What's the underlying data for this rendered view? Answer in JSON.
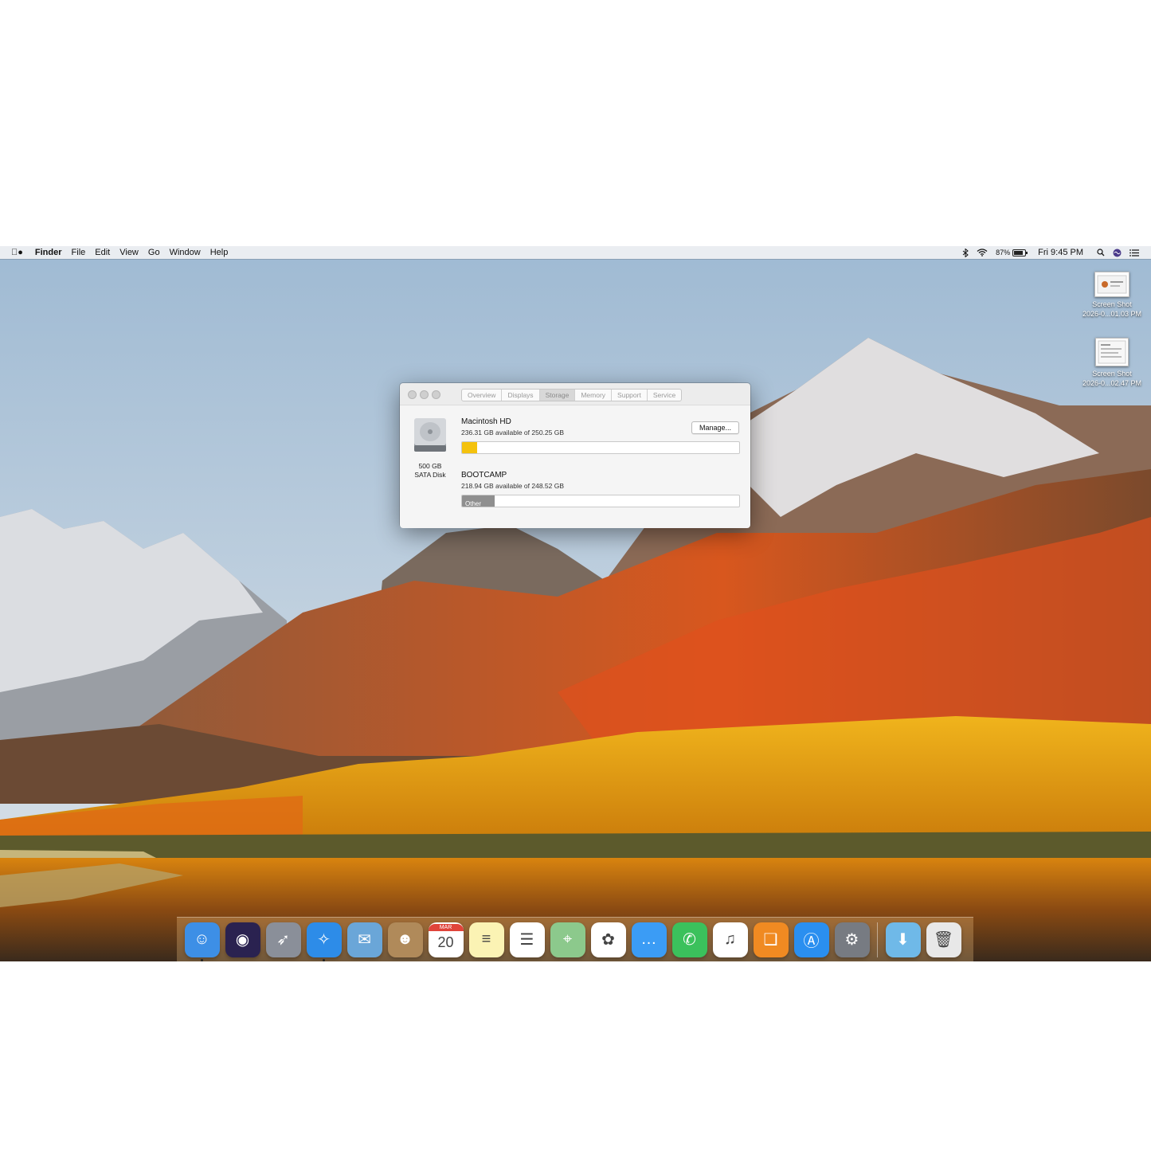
{
  "menubar": {
    "app_name": "Finder",
    "menus": [
      "File",
      "Edit",
      "View",
      "Go",
      "Window",
      "Help"
    ],
    "battery_percent": "87%",
    "battery_level": 0.87,
    "clock": "Fri 9:45 PM"
  },
  "desktop": {
    "icons": [
      {
        "line1": "Screen Shot",
        "line2": "2026-0...01.03 PM"
      },
      {
        "line1": "Screen Shot",
        "line2": "2026-0...02.47 PM"
      }
    ]
  },
  "about_window": {
    "tabs": [
      "Overview",
      "Displays",
      "Storage",
      "Memory",
      "Support",
      "Service"
    ],
    "active_tab": "Storage",
    "disk": {
      "size": "500 GB",
      "type": "SATA Disk"
    },
    "volumes": [
      {
        "name": "Macintosh HD",
        "detail": "236.31 GB available of 250.25 GB",
        "used_fraction": 0.056,
        "bar_color": "#f4c20d",
        "bar_label": ""
      },
      {
        "name": "BOOTCAMP",
        "detail": "218.94 GB available of 248.52 GB",
        "used_fraction": 0.119,
        "bar_color": "#8f8f8f",
        "bar_label": "Other"
      }
    ],
    "manage_button": "Manage..."
  },
  "dock": {
    "apps": [
      {
        "name": "finder-icon",
        "color": "#3d8fe6",
        "glyph": "☺"
      },
      {
        "name": "siri-icon",
        "color": "#2a2250",
        "glyph": "◉"
      },
      {
        "name": "launchpad-icon",
        "color": "#8a8f99",
        "glyph": "➶"
      },
      {
        "name": "safari-icon",
        "color": "#2d8ce8",
        "glyph": "✧"
      },
      {
        "name": "mail-icon",
        "color": "#6aa6d8",
        "glyph": "✉"
      },
      {
        "name": "contacts-icon",
        "color": "#b08a5a",
        "glyph": "☻"
      },
      {
        "name": "calendar-icon",
        "color": "#ffffff",
        "glyph": "20"
      },
      {
        "name": "notes-icon",
        "color": "#fbf3b4",
        "glyph": "≡"
      },
      {
        "name": "reminders-icon",
        "color": "#ffffff",
        "glyph": "☰"
      },
      {
        "name": "maps-icon",
        "color": "#8cc98c",
        "glyph": "⌖"
      },
      {
        "name": "photos-icon",
        "color": "#ffffff",
        "glyph": "✿"
      },
      {
        "name": "messages-icon",
        "color": "#3b9cf5",
        "glyph": "…"
      },
      {
        "name": "facetime-icon",
        "color": "#3bc15c",
        "glyph": "✆"
      },
      {
        "name": "itunes-icon",
        "color": "#ffffff",
        "glyph": "♫"
      },
      {
        "name": "ibooks-icon",
        "color": "#f08a22",
        "glyph": "❑"
      },
      {
        "name": "app-store-icon",
        "color": "#2a8ff0",
        "glyph": "Ⓐ"
      },
      {
        "name": "system-preferences-icon",
        "color": "#777b82",
        "glyph": "⚙"
      }
    ],
    "calendar_month": "MAR",
    "folders": [
      {
        "name": "downloads-folder-icon",
        "color": "#6fb9e8",
        "glyph": "⬇"
      },
      {
        "name": "trash-icon",
        "color": "#e8e8e8",
        "glyph": "🗑"
      }
    ]
  }
}
